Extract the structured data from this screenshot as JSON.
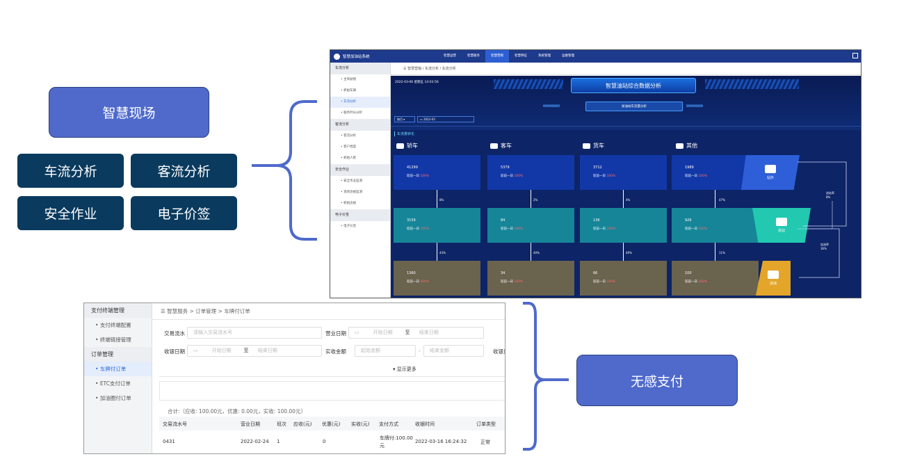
{
  "left_labels": {
    "main": "智慧现场",
    "items": [
      "车流分析",
      "客流分析",
      "安全作业",
      "电子价签"
    ]
  },
  "right_label": "无感支付",
  "dashboard": {
    "app_title": "智慧加油站系统",
    "nav": [
      "智慧运营",
      "智慧服务",
      "智慧营销",
      "智慧特征",
      "系统管理",
      "运维管理"
    ],
    "sidebar": [
      {
        "group": "车流分析",
        "items": [
          "主驾驶舱",
          "抓拍车辆",
          "车流分析",
          "服务时长分析"
        ]
      },
      {
        "group": "客流分析",
        "items": [
          "客流分析",
          "客户档案",
          "抓拍人脸"
        ]
      },
      {
        "group": "安全作业",
        "items": [
          "安全作业监测",
          "现场违规监测",
          "抓拍违规"
        ]
      },
      {
        "group": "电子价签",
        "items": [
          "电子价签"
        ]
      }
    ],
    "breadcrumb": "智慧营销 / 车流分析 / 车流分析",
    "datetime": "2022-03-06 星期五 14:03:56",
    "title": "智慧油站综合数据分析",
    "subtitle": "加油站车流量分析",
    "period_select": "按月",
    "period_value": "2022-03",
    "section": "车流量转化",
    "columns": [
      "轿车",
      "客车",
      "货车",
      "其他"
    ],
    "row1": [
      "41299",
      "5379",
      "3712",
      "1989"
    ],
    "row2": [
      "3159",
      "84",
      "136",
      "926"
    ],
    "row3": [
      "1360",
      "34",
      "66",
      "100"
    ],
    "compare_label": "较前一日",
    "compare_pct": "100%",
    "pct_row1": [
      "8%",
      "2%",
      "4%",
      "47%"
    ],
    "pct_row2": [
      "43%",
      "40%",
      "49%",
      "11%"
    ],
    "tags": [
      "站外",
      "进站",
      "加油"
    ],
    "side_notes": [
      "进站率\n8%",
      "加油率\n36%"
    ],
    "colors": {
      "top": "#1e3a8c",
      "panel": "#0d2466",
      "row1": "#1238a8",
      "row2": "#168598",
      "row3": "#6a634e",
      "tag1": "#2e5fd8",
      "tag2": "#22c9b0",
      "tag3": "#e3a52a"
    }
  },
  "orders": {
    "sidebar": [
      {
        "type": "group",
        "label": "支付终端管理"
      },
      {
        "type": "item",
        "label": "支付终端配置"
      },
      {
        "type": "item",
        "label": "终端链接管理"
      },
      {
        "type": "group",
        "label": "订单管理"
      },
      {
        "type": "item",
        "label": "车牌付订单",
        "active": true
      },
      {
        "type": "item",
        "label": "ETC支付订单"
      },
      {
        "type": "item",
        "label": "加油圈付订单"
      }
    ],
    "breadcrumb": "智慧服务 > 订单管理 > 车牌付订单",
    "filters": {
      "txn_label": "交易流水",
      "txn_placeholder": "请输入交易流水号",
      "biz_date_label": "营业日期",
      "start_date": "开始日期",
      "to": "至",
      "end_date": "结束日期",
      "recv_date_label": "收银日期",
      "amount_label": "实收金额",
      "start_amount": "起始金额",
      "dash": "-",
      "end_amount": "结束金额",
      "recv_label_cut": "收银员",
      "more": "显示更多"
    },
    "summary": "合计:（应收: 100.00元，优惠: 0.00元，实收: 100.00元）",
    "table_headers": [
      "交易流水号",
      "营业日期",
      "班次",
      "应收(元)",
      "优惠(元)",
      "实收(元)",
      "支付方式",
      "收银时间",
      "订单类型"
    ],
    "table_rows": [
      [
        "0431",
        "2022-02-24",
        "1",
        "",
        "0",
        "",
        "车牌付:100.00元",
        "2022-03-16 16:24:32",
        "正常"
      ]
    ]
  }
}
